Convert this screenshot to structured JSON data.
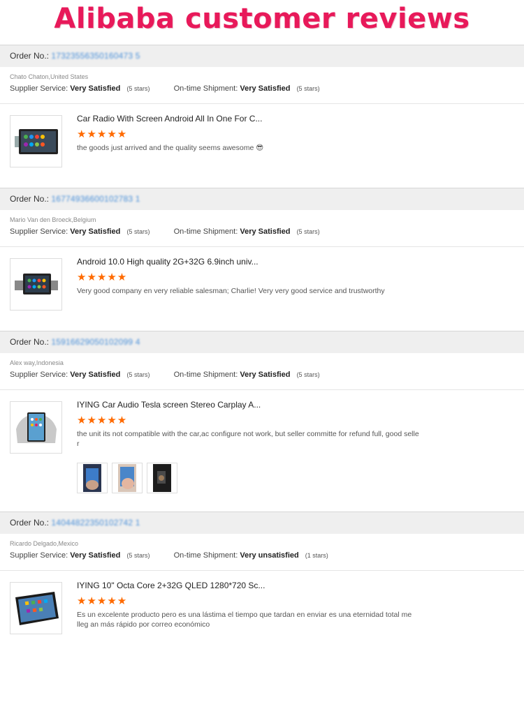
{
  "banner": {
    "title": "Alibaba customer reviews"
  },
  "labels": {
    "order_no": "Order No.:",
    "supplier_service": "Supplier Service:",
    "ontime_shipment": "On-time Shipment:"
  },
  "orders": [
    {
      "order_no": "17323556350160473 5",
      "buyer": "Chato Chaton,United States",
      "supplier_rating": "Very Satisfied",
      "supplier_stars": "(5 stars)",
      "shipment_rating": "Very Satisfied",
      "shipment_stars": "(5 stars)",
      "product_title": "Car Radio With Screen Android All In One For C...",
      "stars": "★★★★★",
      "comment": "the goods just arrived and the quality seems awesome 😎",
      "thumb_icon": "car-radio-double-din-icon"
    },
    {
      "order_no": "16774936600102783 1",
      "buyer": "Mario Van den Broeck,Belgium",
      "supplier_rating": "Very Satisfied",
      "supplier_stars": "(5 stars)",
      "shipment_rating": "Very Satisfied",
      "shipment_stars": "(5 stars)",
      "product_title": "Android 10.0 High quality 2G+32G 6.9inch univ...",
      "stars": "★★★★★",
      "comment": "Very good company en very reliable salesman; Charlie!   Very very good service and trustworthy",
      "thumb_icon": "car-radio-single-din-icon"
    },
    {
      "order_no": "15916629050102099 4",
      "buyer": "Alex way,Indonesia",
      "supplier_rating": "Very Satisfied",
      "supplier_stars": "(5 stars)",
      "shipment_rating": "Very Satisfied",
      "shipment_stars": "(5 stars)",
      "product_title": "IYING Car Audio Tesla screen Stereo Carplay A...",
      "stars": "★★★★★",
      "comment": "the unit its not compatible with the car,ac configure not work, but seller committe for refund full, good selle r",
      "thumb_icon": "tesla-style-vertical-screen-icon"
    },
    {
      "order_no": "14044822350102742 1",
      "buyer": "Ricardo Delgado,Mexico",
      "supplier_rating": "Very Satisfied",
      "supplier_stars": "(5 stars)",
      "shipment_rating": "Very unsatisfied",
      "shipment_stars": "(1 stars)",
      "product_title": "IYING 10\" Octa Core 2+32G QLED 1280*720 Sc...",
      "stars": "★★★★★",
      "comment": "Es un excelente producto pero es una lástima el tiempo que tardan en enviar es una eternidad total me lleg an más rápido por correo económico",
      "thumb_icon": "tablet-screen-icon"
    }
  ],
  "colors": {
    "title": "#e8195a",
    "stars": "#ff6a00",
    "order_link": "#4a90d9"
  }
}
